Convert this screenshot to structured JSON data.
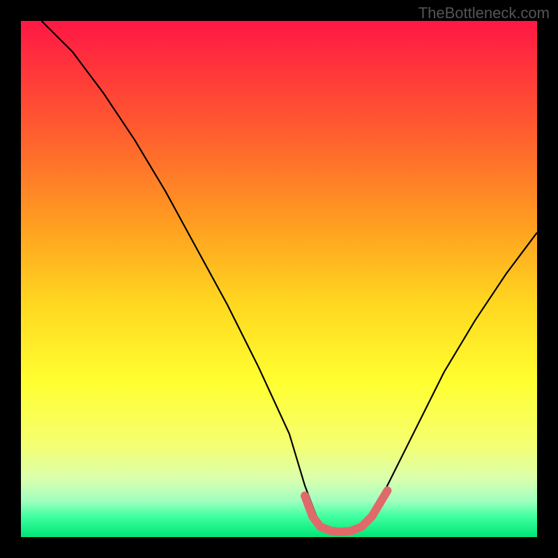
{
  "watermark": "TheBottleneck.com",
  "chart_data": {
    "type": "line",
    "title": "",
    "xlabel": "",
    "ylabel": "",
    "xlim": [
      0,
      100
    ],
    "ylim": [
      0,
      100
    ],
    "grid": false,
    "legend": false,
    "background_gradient": {
      "stops": [
        {
          "offset": 0,
          "color": "#ff1744"
        },
        {
          "offset": 20,
          "color": "#ff5830"
        },
        {
          "offset": 40,
          "color": "#ffa020"
        },
        {
          "offset": 55,
          "color": "#ffd820"
        },
        {
          "offset": 70,
          "color": "#ffff30"
        },
        {
          "offset": 82,
          "color": "#f5ff70"
        },
        {
          "offset": 89,
          "color": "#d8ffb0"
        },
        {
          "offset": 93,
          "color": "#a0ffc0"
        },
        {
          "offset": 96,
          "color": "#40ffa0"
        },
        {
          "offset": 100,
          "color": "#00e676"
        }
      ]
    },
    "series": [
      {
        "name": "bottleneck-curve",
        "color": "#000000",
        "x": [
          4,
          10,
          16,
          22,
          28,
          34,
          40,
          46,
          52,
          55,
          58,
          62,
          66,
          70,
          76,
          82,
          88,
          94,
          100
        ],
        "values": [
          100,
          94,
          86,
          77,
          67,
          56,
          45,
          33,
          20,
          10,
          2,
          1,
          2,
          8,
          20,
          32,
          42,
          51,
          59
        ]
      }
    ],
    "highlight_segment": {
      "name": "optimal-zone",
      "color": "#e06a6a",
      "x": [
        55,
        56.5,
        58,
        60,
        62,
        64,
        66,
        68,
        69.5,
        71
      ],
      "values": [
        8,
        4,
        2,
        1.2,
        1,
        1.2,
        2,
        4,
        6.5,
        9
      ]
    }
  }
}
